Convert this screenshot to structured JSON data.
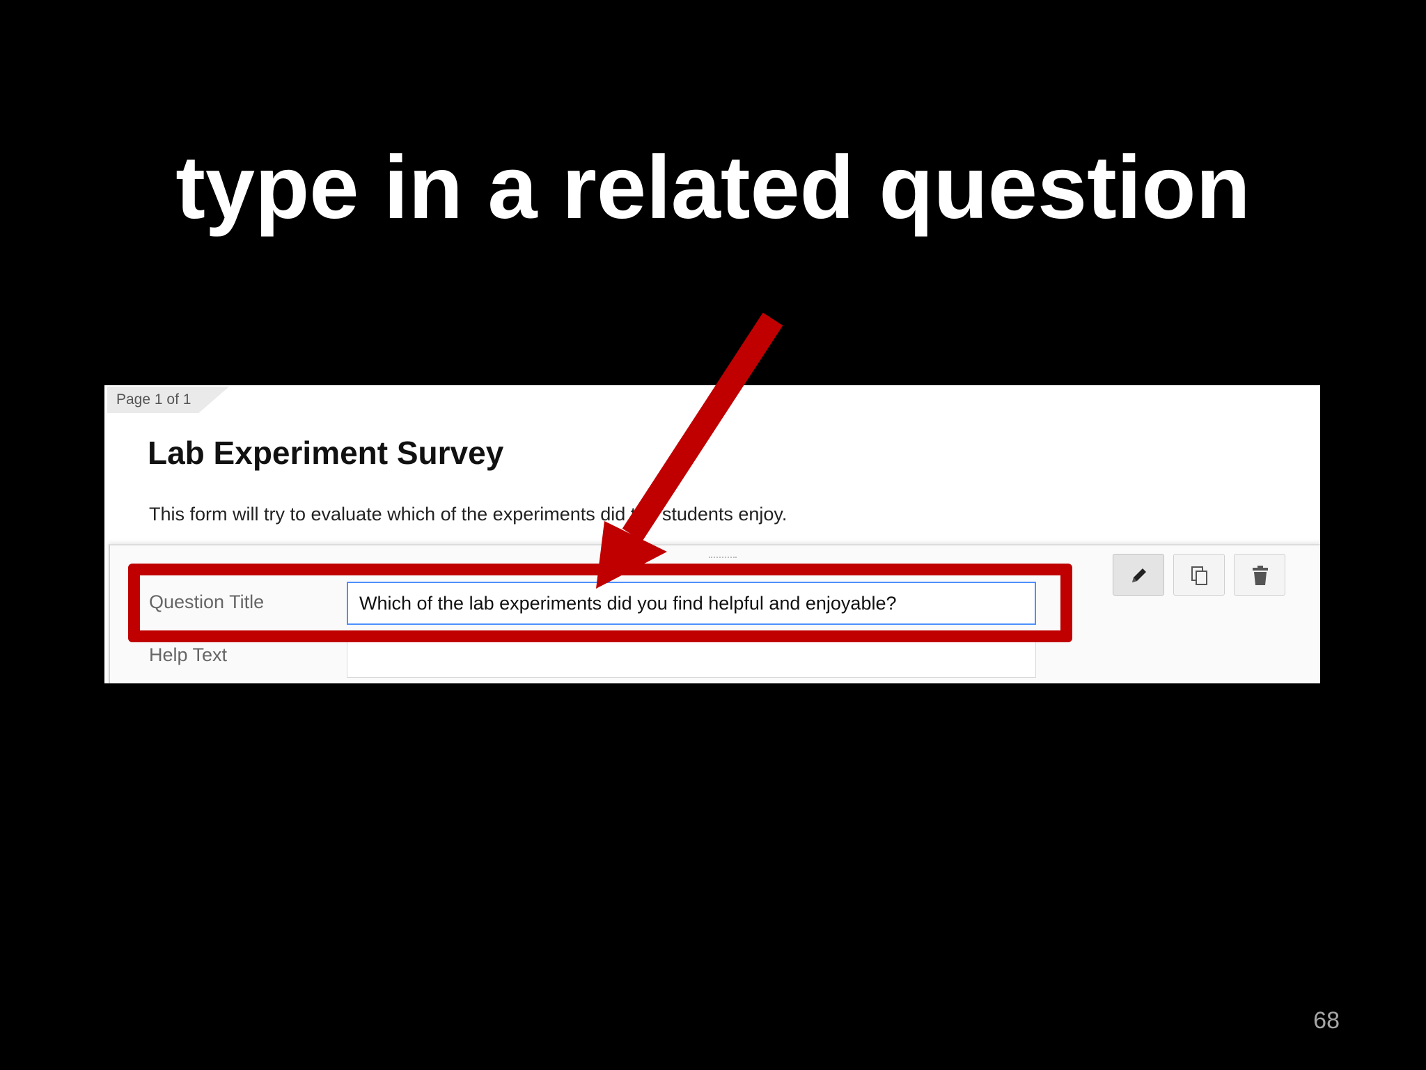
{
  "slide": {
    "title": "type in a related question",
    "page_number": "68"
  },
  "form": {
    "page_indicator": "Page 1 of 1",
    "title": "Lab Experiment Survey",
    "description": "This form will try to evaluate which of the experiments did the students enjoy.",
    "question_title_label": "Question Title",
    "question_title_value": "Which of the lab experiments did you find helpful and enjoyable?",
    "help_text_label": "Help Text",
    "help_text_value": ""
  },
  "toolbar": {
    "buttons": [
      {
        "icon": "pencil-icon",
        "state": "active"
      },
      {
        "icon": "duplicate-icon",
        "state": "normal"
      },
      {
        "icon": "trash-icon",
        "state": "normal"
      }
    ]
  },
  "annotation": {
    "color": "#c00000",
    "type": "arrow-and-box"
  },
  "colors": {
    "background": "#000000",
    "title_text": "#ffffff",
    "focus_border": "#4d90fe"
  }
}
